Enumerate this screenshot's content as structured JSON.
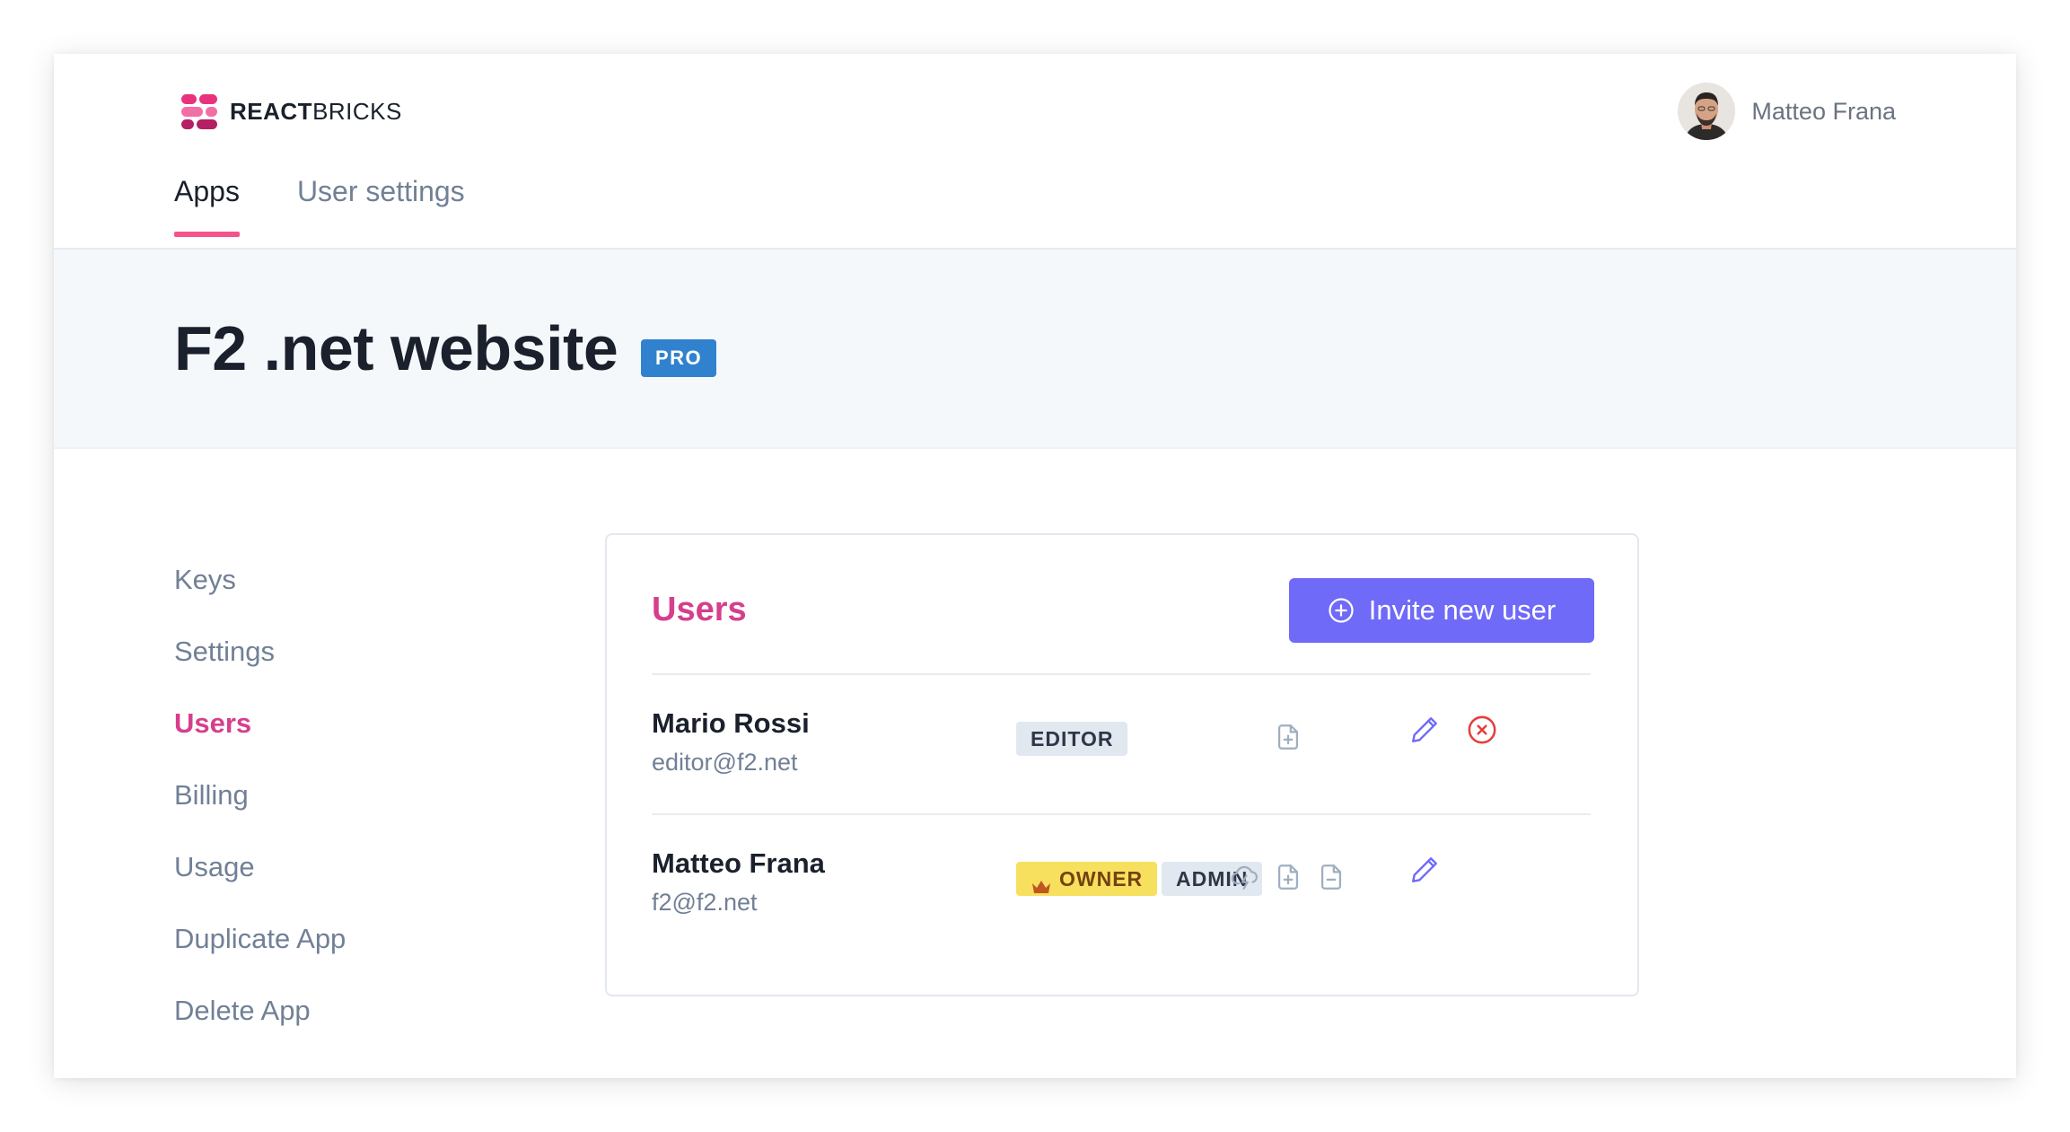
{
  "brand": {
    "name_bold": "REACT",
    "name_rest": "BRICKS"
  },
  "user": {
    "name": "Matteo Frana"
  },
  "tabs": [
    {
      "label": "Apps",
      "active": true
    },
    {
      "label": "User settings",
      "active": false
    }
  ],
  "app": {
    "title": "F2 .net website",
    "plan_badge": "PRO"
  },
  "sidebar": {
    "items": [
      {
        "label": "Keys",
        "active": false
      },
      {
        "label": "Settings",
        "active": false
      },
      {
        "label": "Users",
        "active": true
      },
      {
        "label": "Billing",
        "active": false
      },
      {
        "label": "Usage",
        "active": false
      },
      {
        "label": "Duplicate App",
        "active": false
      },
      {
        "label": "Delete App",
        "active": false
      }
    ]
  },
  "users_panel": {
    "title": "Users",
    "invite_label": "Invite new user",
    "rows": [
      {
        "name": "Mario Rossi",
        "email": "editor@f2.net",
        "roles": [
          "EDITOR"
        ],
        "permission_icons": [
          "file-plus-icon"
        ],
        "actions": [
          "edit-icon",
          "remove-icon"
        ]
      },
      {
        "name": "Matteo Frana",
        "email": "f2@f2.net",
        "roles": [
          "OWNER",
          "ADMIN"
        ],
        "permission_icons": [
          "cloud-lightning-icon",
          "file-plus-icon",
          "file-minus-icon"
        ],
        "actions": [
          "edit-icon"
        ]
      }
    ]
  },
  "colors": {
    "accent_pink": "#d53f8c",
    "tab_underline": "#f3548b",
    "button_purple": "#6f6af8",
    "pro_blue": "#3182ce",
    "owner_yellow": "#f6e05e",
    "remove_red": "#e53e3e"
  }
}
